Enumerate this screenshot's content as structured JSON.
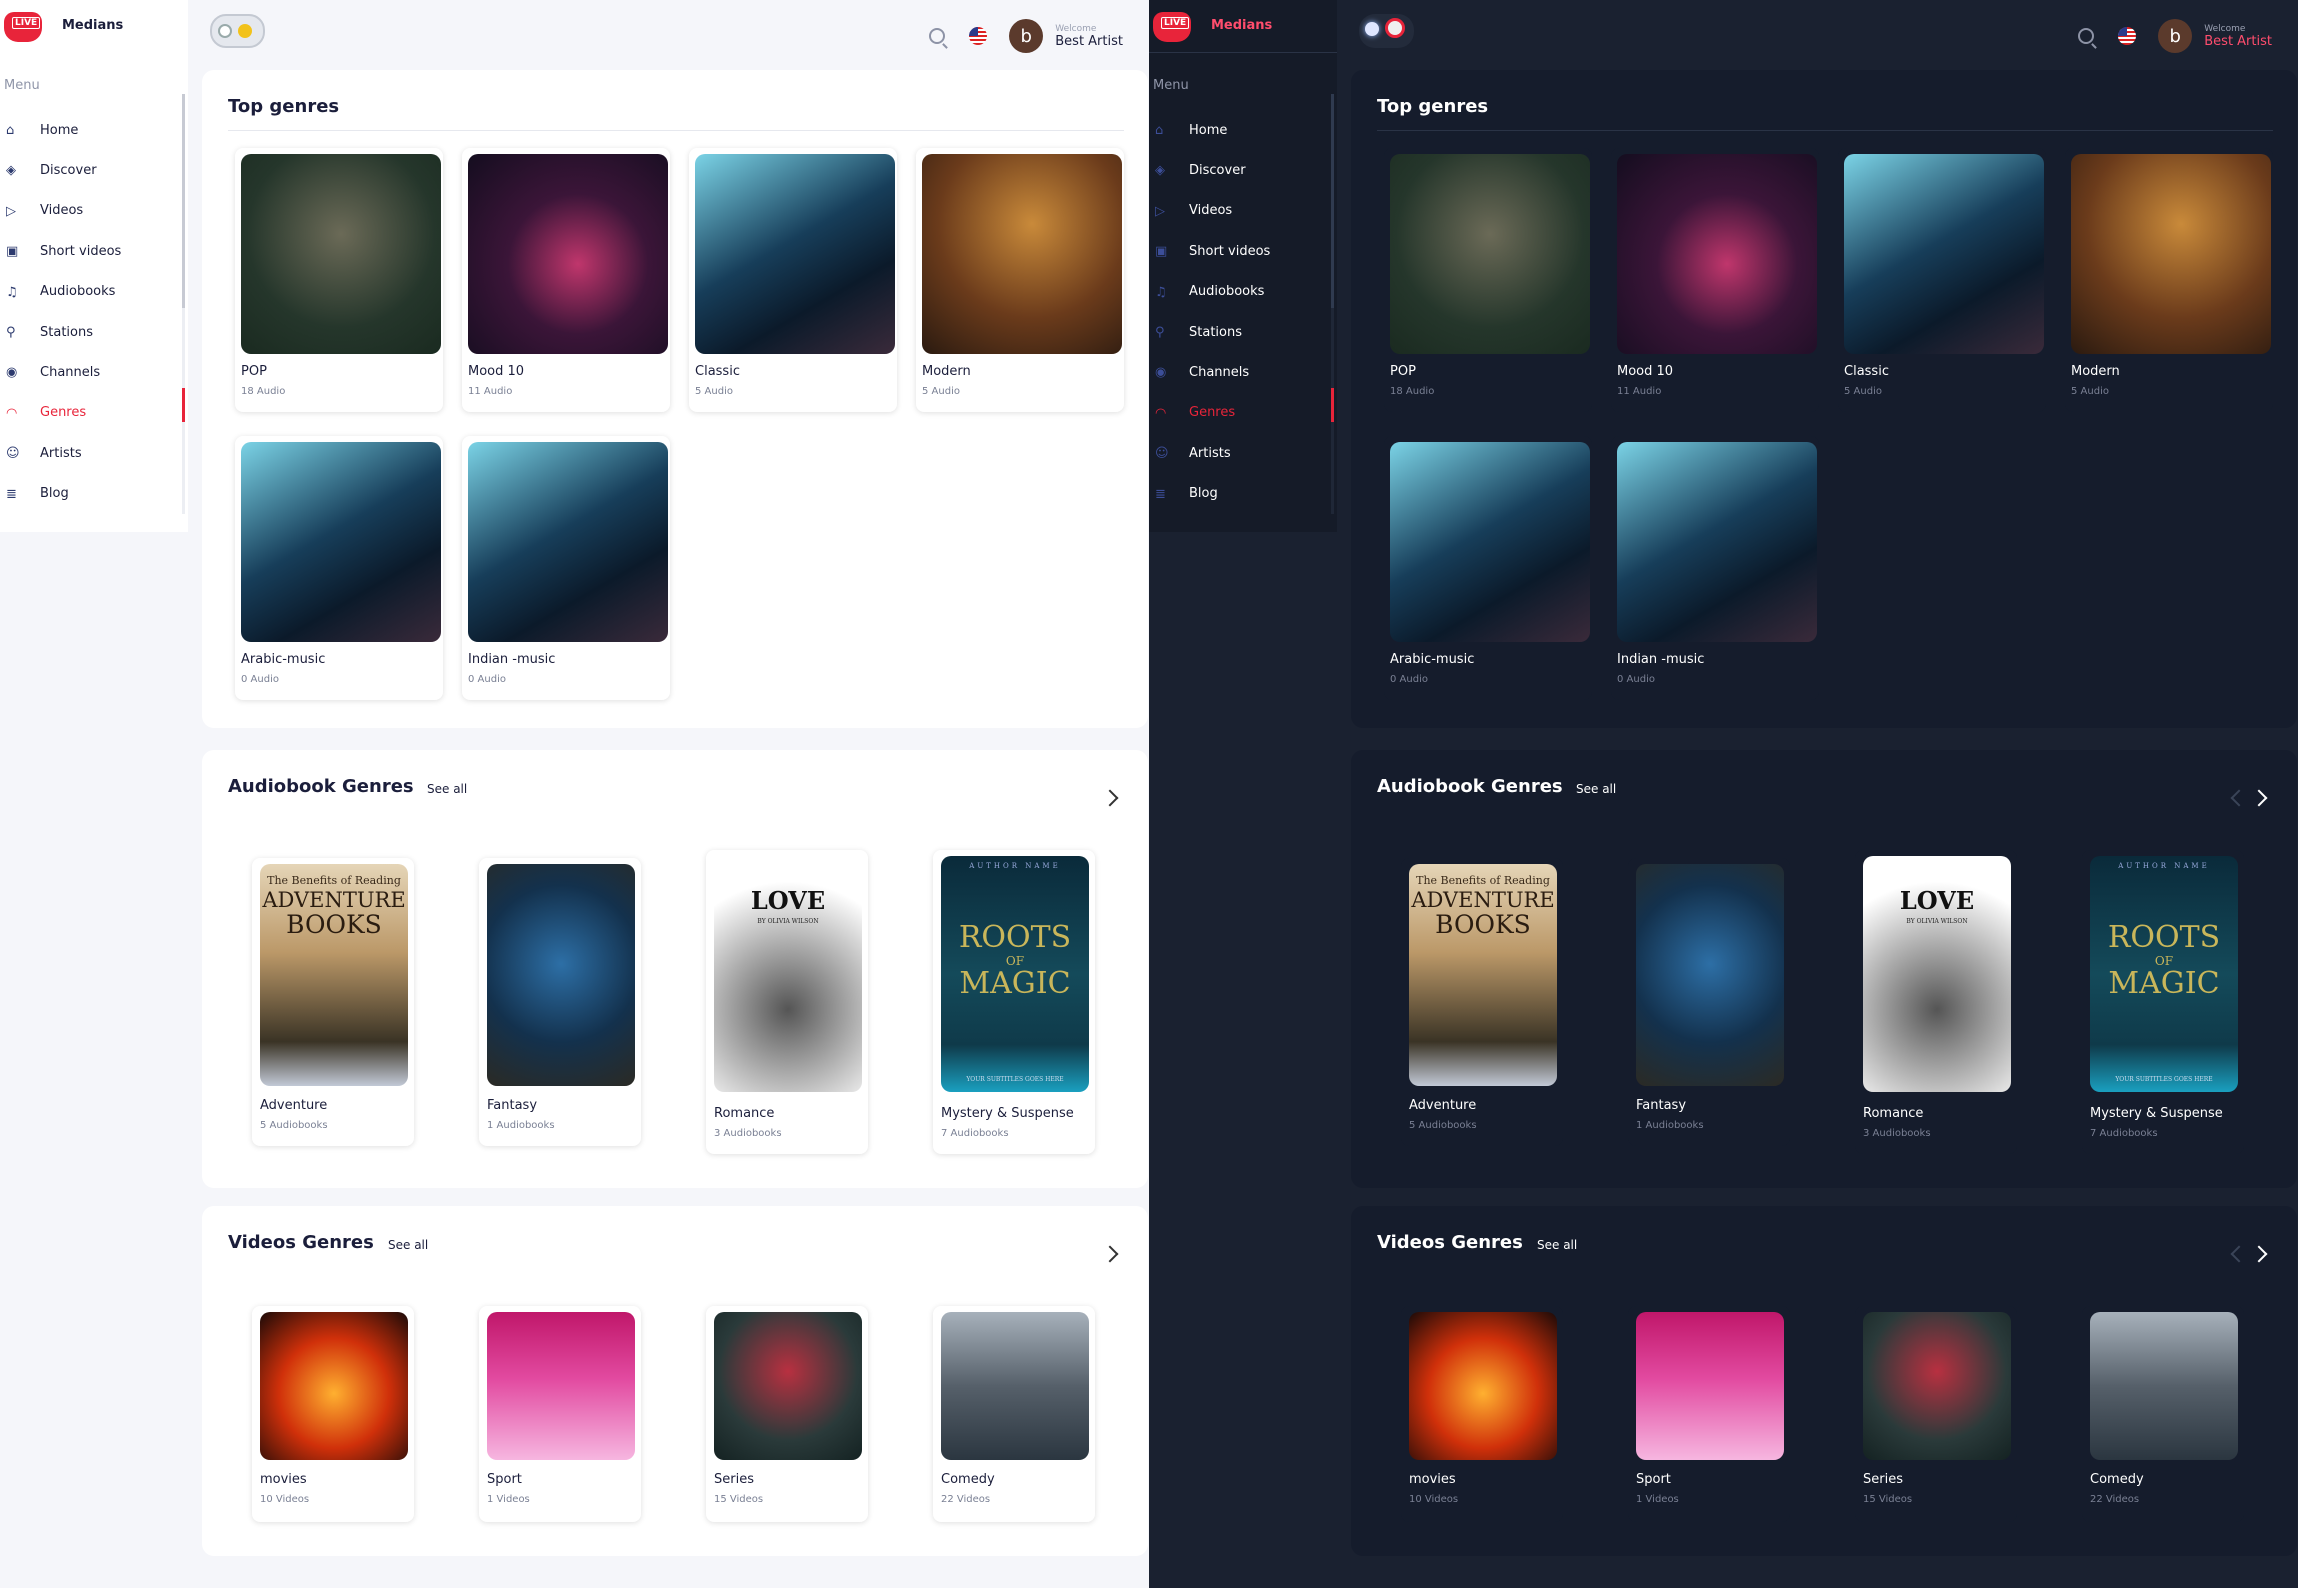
{
  "app": {
    "brand": "Medians",
    "logo_text": "LIVE",
    "menu_title": "Menu"
  },
  "nav": [
    {
      "label": "Home",
      "icon": "home-icon"
    },
    {
      "label": "Discover",
      "icon": "discover-icon"
    },
    {
      "label": "Videos",
      "icon": "play-icon"
    },
    {
      "label": "Short videos",
      "icon": "short-video-icon"
    },
    {
      "label": "Audiobooks",
      "icon": "headphones-icon"
    },
    {
      "label": "Stations",
      "icon": "antenna-icon"
    },
    {
      "label": "Channels",
      "icon": "broadcast-icon"
    },
    {
      "label": "Genres",
      "icon": "genres-icon"
    },
    {
      "label": "Artists",
      "icon": "artists-icon"
    },
    {
      "label": "Blog",
      "icon": "blog-icon"
    }
  ],
  "active_nav": "Genres",
  "header": {
    "avatar_letter": "b",
    "welcome": "Welcome",
    "user_name": "Best Artist"
  },
  "top_genres": {
    "title": "Top genres",
    "items": [
      {
        "title": "POP",
        "sub": "18 Audio"
      },
      {
        "title": "Mood 10",
        "sub": "11 Audio"
      },
      {
        "title": "Classic",
        "sub": "5 Audio"
      },
      {
        "title": "Modern",
        "sub": "5 Audio"
      },
      {
        "title": "Arabic-music",
        "sub": "0 Audio"
      },
      {
        "title": "Indian -music",
        "sub": "0 Audio"
      }
    ]
  },
  "audiobook_genres": {
    "title": "Audiobook Genres",
    "see_all": "See all",
    "items": [
      {
        "title": "Adventure",
        "sub": "5 Audiobooks"
      },
      {
        "title": "Fantasy",
        "sub": "1 Audiobooks"
      },
      {
        "title": "Romance",
        "sub": "3 Audiobooks"
      },
      {
        "title": "Mystery & Suspense",
        "sub": "7 Audiobooks"
      }
    ]
  },
  "book_covers": {
    "adventure_top": "The Benefits of Reading",
    "adventure_1": "ADVENTURE",
    "adventure_2": "BOOKS",
    "romance": "LOVE",
    "romance_author": "BY OLIVIA WILSON",
    "mystery_author": "AUTHOR NAME",
    "mystery_1": "ROOTS",
    "mystery_2": "OF",
    "mystery_3": "MAGIC",
    "mystery_sub": "YOUR SUBTITLES GOES HERE"
  },
  "video_genres": {
    "title": "Videos Genres",
    "see_all": "See all",
    "items": [
      {
        "title": "movies",
        "sub": "10 Videos"
      },
      {
        "title": "Sport",
        "sub": "1 Videos"
      },
      {
        "title": "Series",
        "sub": "15 Videos"
      },
      {
        "title": "Comedy",
        "sub": "22 Videos"
      }
    ]
  },
  "colors": {
    "accent": "#e8243a",
    "dark_bg": "#1a2130",
    "light_bg": "#f5f6fa"
  }
}
